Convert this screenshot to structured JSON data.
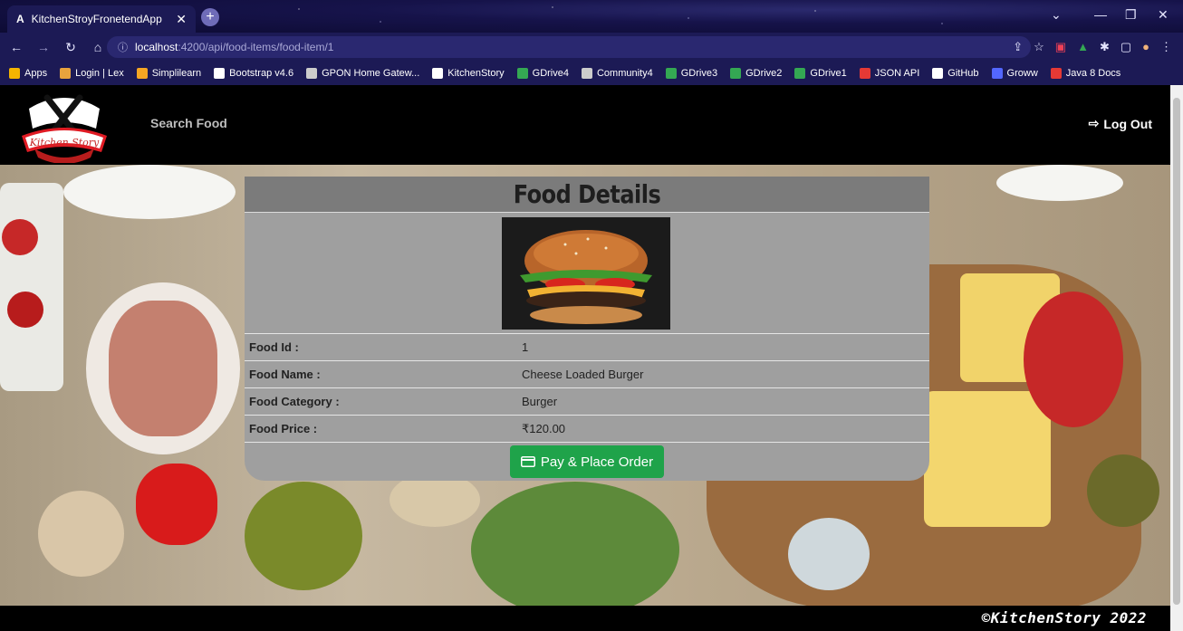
{
  "browser": {
    "tab_title": "KitchenStroyFronetendApp",
    "tab_favicon": "A",
    "url_host": "localhost",
    "url_path": ":4200/api/food-items/food-item/1",
    "bookmarks": [
      {
        "label": "Apps",
        "icon": "apps-grid-icon",
        "color": "#f4b400"
      },
      {
        "label": "Login | Lex",
        "icon": "lex-icon",
        "color": "#e8a33d"
      },
      {
        "label": "Simplilearn",
        "icon": "simplilearn-icon",
        "color": "#f5a623"
      },
      {
        "label": "Bootstrap v4.6",
        "icon": "bootstrap-icon",
        "color": "#ffffff"
      },
      {
        "label": "GPON Home Gatew...",
        "icon": "globe-icon",
        "color": "#cccccc"
      },
      {
        "label": "KitchenStory",
        "icon": "angular-icon",
        "color": "#ffffff"
      },
      {
        "label": "GDrive4",
        "icon": "gdrive-icon",
        "color": "#34a853"
      },
      {
        "label": "Community4",
        "icon": "globe-icon",
        "color": "#cccccc"
      },
      {
        "label": "GDrive3",
        "icon": "gdrive-icon",
        "color": "#34a853"
      },
      {
        "label": "GDrive2",
        "icon": "gdrive-icon",
        "color": "#34a853"
      },
      {
        "label": "GDrive1",
        "icon": "gdrive-icon",
        "color": "#34a853"
      },
      {
        "label": "JSON API",
        "icon": "json-icon",
        "color": "#e53935"
      },
      {
        "label": "GitHub",
        "icon": "github-icon",
        "color": "#ffffff"
      },
      {
        "label": "Groww",
        "icon": "groww-icon",
        "color": "#5367ff"
      },
      {
        "label": "Java 8 Docs",
        "icon": "oracle-icon",
        "color": "#e53935"
      }
    ]
  },
  "nav": {
    "logo_text": "Kitchen Story",
    "search_label": "Search Food",
    "logout_label": "Log Out"
  },
  "card": {
    "title": "Food Details",
    "fields": [
      {
        "label": "Food Id :",
        "value": "1"
      },
      {
        "label": "Food Name :",
        "value": "Cheese Loaded Burger"
      },
      {
        "label": "Food Category :",
        "value": "Burger"
      },
      {
        "label": "Food Price :",
        "value": "₹120.00"
      }
    ],
    "button_label": "Pay & Place Order"
  },
  "footer": {
    "copyright": "©KitchenStory 2022"
  },
  "colors": {
    "accent_button": "#1fa34a",
    "nav_bg": "#000000",
    "card_bg": "#9f9f9f",
    "card_header_bg": "#7b7b7b"
  }
}
